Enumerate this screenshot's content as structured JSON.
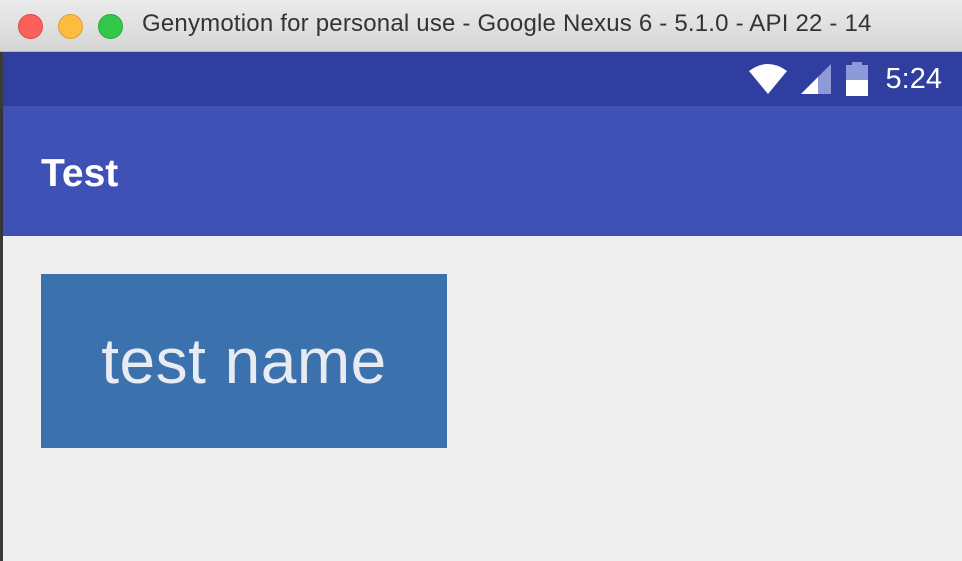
{
  "window": {
    "title": "Genymotion for personal use - Google Nexus 6 - 5.1.0 - API 22 - 14",
    "controls": [
      "close",
      "minimize",
      "maximize"
    ]
  },
  "status_bar": {
    "time": "5:24",
    "icons": [
      "wifi-icon",
      "cell-signal-icon",
      "battery-icon"
    ],
    "color": "#303f9f"
  },
  "app_bar": {
    "title": "Test",
    "color": "#3f51b5"
  },
  "main": {
    "name_label": "test name",
    "box_color": "#3b71ad",
    "background": "#eeeeee"
  }
}
